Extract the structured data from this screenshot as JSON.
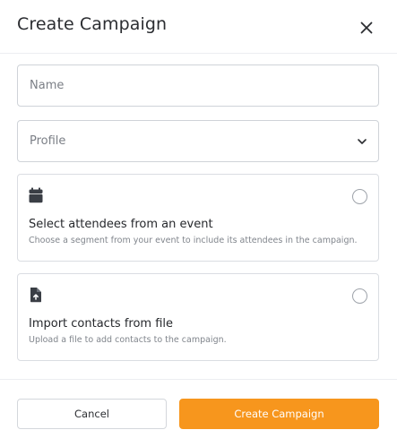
{
  "dialog": {
    "title": "Create Campaign"
  },
  "form": {
    "name_placeholder": "Name",
    "name_value": "",
    "profile_selected": "Profile"
  },
  "options": [
    {
      "icon": "calendar-icon",
      "title": "Select attendees from an event",
      "description": "Choose a segment from your event to include its attendees in the campaign.",
      "selected": false
    },
    {
      "icon": "file-upload-icon",
      "title": "Import contacts from file",
      "description": "Upload a file to add contacts to the campaign.",
      "selected": false
    }
  ],
  "footer": {
    "cancel_label": "Cancel",
    "create_label": "Create Campaign"
  },
  "colors": {
    "accent": "#f7961d",
    "border": "#cfd3d8",
    "text": "#2d2f33",
    "muted": "#80858c"
  }
}
